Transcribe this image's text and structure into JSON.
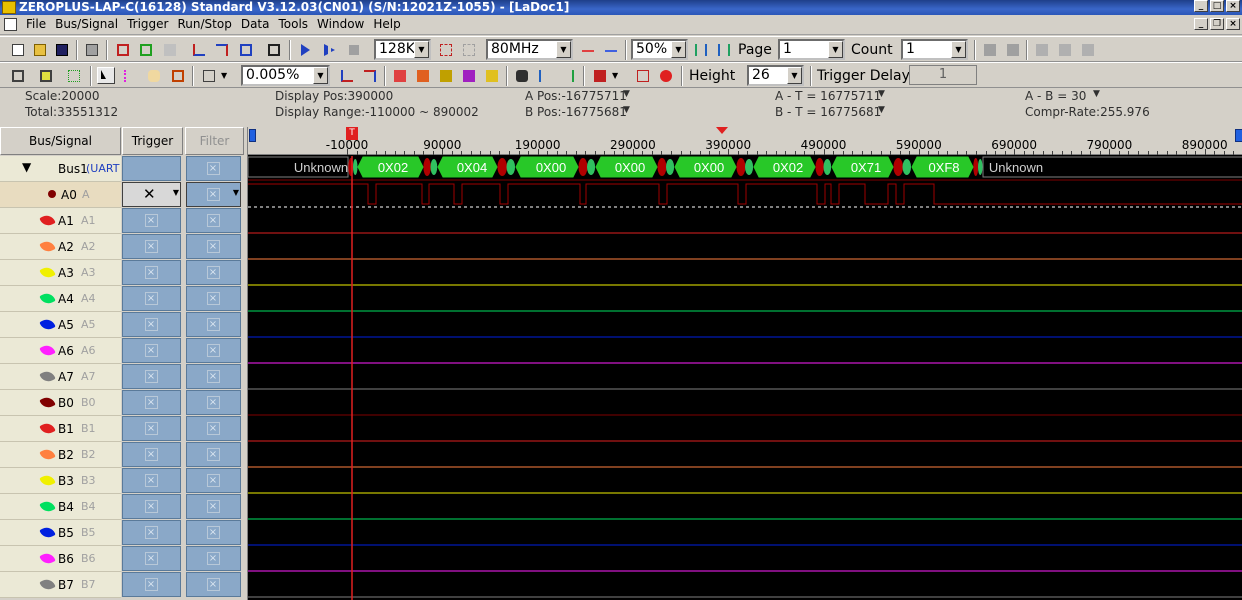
{
  "window": {
    "title": "ZEROPLUS-LAP-C(16128) Standard V3.12.03(CN01) (S/N:12021Z-1055) - [LaDoc1]"
  },
  "menu": [
    "File",
    "Bus/Signal",
    "Trigger",
    "Run/Stop",
    "Data",
    "Tools",
    "Window",
    "Help"
  ],
  "toolbar": {
    "memory_depth": "128K",
    "sample_rate": "80MHz",
    "trigger_position": "50%",
    "page_label": "Page",
    "page_value": "1",
    "count_label": "Count",
    "count_value": "1",
    "zoom_value": "0.005%",
    "height_label": "Height",
    "height_value": "26",
    "trigger_delay_label": "Trigger Delay",
    "trigger_delay_value": "1"
  },
  "info": {
    "scale": "Scale:20000",
    "total": "Total:33551312",
    "display_pos": "Display Pos:390000",
    "display_range": "Display Range:-110000 ~ 890002",
    "a_pos": "A Pos:-16775711",
    "b_pos": "B Pos:-16775681",
    "a_t": "A - T = 16775711",
    "b_t": "B - T = 16775681",
    "a_b": "A - B = 30",
    "compr_rate": "Compr-Rate:255.976"
  },
  "columns": {
    "bus_signal": "Bus/Signal",
    "trigger": "Trigger",
    "filter": "Filter"
  },
  "bus": {
    "name": "Bus1",
    "protocol": "(UART"
  },
  "signals": [
    {
      "name": "A0",
      "alias": "A",
      "color": "#800000"
    },
    {
      "name": "A1",
      "alias": "A1",
      "color": "#e02020"
    },
    {
      "name": "A2",
      "alias": "A2",
      "color": "#ff8040"
    },
    {
      "name": "A3",
      "alias": "A3",
      "color": "#f0f000"
    },
    {
      "name": "A4",
      "alias": "A4",
      "color": "#00e060"
    },
    {
      "name": "A5",
      "alias": "A5",
      "color": "#0020e0"
    },
    {
      "name": "A6",
      "alias": "A6",
      "color": "#ff20ff"
    },
    {
      "name": "A7",
      "alias": "A7",
      "color": "#808080"
    },
    {
      "name": "B0",
      "alias": "B0",
      "color": "#800000"
    },
    {
      "name": "B1",
      "alias": "B1",
      "color": "#e02020"
    },
    {
      "name": "B2",
      "alias": "B2",
      "color": "#ff8040"
    },
    {
      "name": "B3",
      "alias": "B3",
      "color": "#f0f000"
    },
    {
      "name": "B4",
      "alias": "B4",
      "color": "#00e060"
    },
    {
      "name": "B5",
      "alias": "B5",
      "color": "#0020e0"
    },
    {
      "name": "B6",
      "alias": "B6",
      "color": "#ff20ff"
    },
    {
      "name": "B7",
      "alias": "B7",
      "color": "#808080"
    }
  ],
  "ruler": {
    "ticks": [
      "-10000",
      "90000",
      "190000",
      "290000",
      "390000",
      "490000",
      "590000",
      "690000",
      "790000",
      "890000"
    ],
    "trigger_marker": "T"
  },
  "decoded": [
    "Unknown",
    "0X02",
    "0X04",
    "0X00",
    "0X00",
    "0X00",
    "0X02",
    "0X71",
    "0XF8",
    "Unknown"
  ]
}
